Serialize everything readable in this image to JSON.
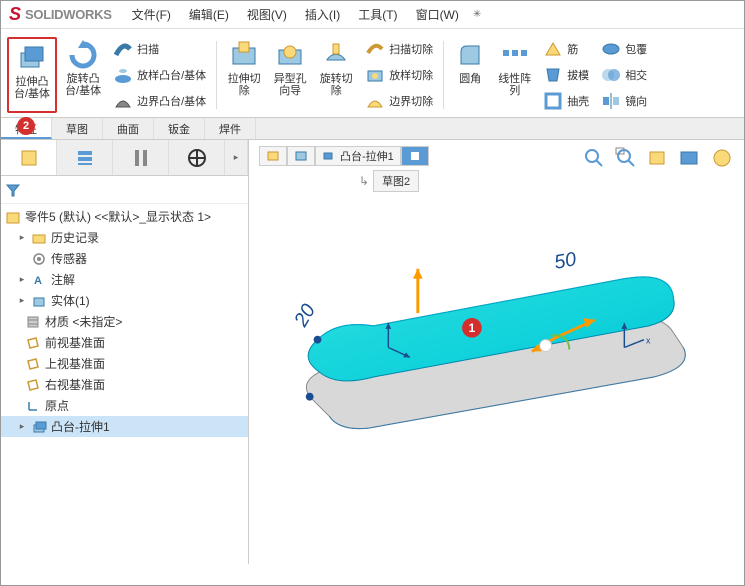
{
  "app": {
    "name": "SOLIDWORKS"
  },
  "menu": [
    "文件(F)",
    "编辑(E)",
    "视图(V)",
    "插入(I)",
    "工具(T)",
    "窗口(W)"
  ],
  "ribbon": {
    "extrude_boss": "拉伸凸\n台/基体",
    "revolve_boss": "旋转凸\n台/基体",
    "sweep": "扫描",
    "loft": "放样凸台/基体",
    "boundary": "边界凸台/基体",
    "extrude_cut": "拉伸切\n除",
    "hole_wizard": "异型孔\n向导",
    "revolve_cut": "旋转切\n除",
    "sweep_cut": "扫描切除",
    "loft_cut": "放样切除",
    "boundary_cut": "边界切除",
    "fillet": "圆角",
    "linear_pattern": "线性阵\n列",
    "rib": "筋",
    "draft": "拔模",
    "shell": "抽壳",
    "wrap": "包覆",
    "intersect": "相交",
    "mirror": "镜向"
  },
  "tabs": [
    "特征",
    "草图",
    "曲面",
    "钣金",
    "焊件"
  ],
  "active_tab": 0,
  "breadcrumb": {
    "current": "凸台-拉伸1",
    "sub": "草图2"
  },
  "tree": {
    "root": "零件5 (默认) <<默认>_显示状态 1>",
    "items": [
      {
        "icon": "folder",
        "label": "历史记录",
        "expand": "▸"
      },
      {
        "icon": "sensor",
        "label": "传感器",
        "expand": ""
      },
      {
        "icon": "annotation",
        "label": "注解",
        "expand": "▸"
      },
      {
        "icon": "body",
        "label": "实体(1)",
        "expand": "▸"
      },
      {
        "icon": "material",
        "label": "材质 <未指定>",
        "expand": ""
      },
      {
        "icon": "plane",
        "label": "前视基准面",
        "expand": ""
      },
      {
        "icon": "plane",
        "label": "上视基准面",
        "expand": ""
      },
      {
        "icon": "plane",
        "label": "右视基准面",
        "expand": ""
      },
      {
        "icon": "origin",
        "label": "原点",
        "expand": ""
      },
      {
        "icon": "feature",
        "label": "凸台-拉伸1",
        "expand": "▸",
        "selected": true
      }
    ]
  },
  "badges": {
    "one": "1",
    "two": "2"
  },
  "dimensions": {
    "width": "50",
    "height": "20"
  },
  "chart_data": null
}
